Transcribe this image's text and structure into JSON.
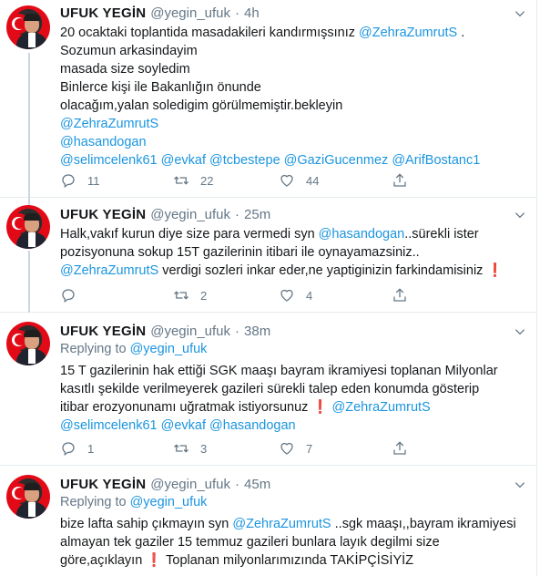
{
  "colors": {
    "link": "#1b95e0",
    "muted": "#657786",
    "text": "#14171a",
    "alarm": "#e0245e"
  },
  "icons": {
    "reply": "reply-icon",
    "retweet": "retweet-icon",
    "like": "heart-icon",
    "share": "share-icon",
    "caret": "chevron-down-icon"
  },
  "tweets": [
    {
      "name": "UFUK YEGİN",
      "handle": "@yegin_ufuk",
      "dot": "·",
      "time": "4h",
      "lines": [
        {
          "a": "20 ocaktaki toplantida masadakileri kandırmışsınız ",
          "m": "@ZehraZumrutS",
          "b": " ."
        },
        {
          "a": "Sozumun arkasindayim"
        },
        {
          "a": "masada size soyledim"
        },
        {
          "a": "Binlerce kişi ile Bakanlığın önunde"
        },
        {
          "a": "olacağım,yalan soledigim görülmemiştir.bekleyin"
        },
        {
          "m": "@ZehraZumrutS"
        },
        {
          "m": "@hasandogan"
        },
        {
          "m": "@selimcelenk61 @evkaf @tcbestepe @GaziGucenmez @ArifBostanc1"
        }
      ],
      "replies": "11",
      "retweets": "22",
      "likes": "44"
    },
    {
      "name": "UFUK YEGİN",
      "handle": "@yegin_ufuk",
      "dot": "·",
      "time": "25m",
      "lines": [
        {
          "a": "Halk,vakıf kurun diye size para vermedi syn ",
          "m": "@hasandogan",
          "b": "..sürekli ister"
        },
        {
          "a": "pozisyonuna sokup 15T gazilerinin itibari ile oynayamazsiniz.."
        },
        {
          "m": "@ZehraZumrutS",
          "b": " verdigi sozleri inkar eder,ne yaptiginizin farkindamisiniz ",
          "e": "❗"
        }
      ],
      "replies": "",
      "retweets": "2",
      "likes": "4"
    },
    {
      "name": "UFUK YEGİN",
      "handle": "@yegin_ufuk",
      "dot": "·",
      "time": "38m",
      "replying_prefix": "Replying to ",
      "replying_to": "@yegin_ufuk",
      "lines": [
        {
          "a": "15 T gazilerinin hak ettiği SGK maaşı bayram ikramiyesi toplanan Milyonlar"
        },
        {
          "a": "kasıtlı şekilde verilmeyerek gazileri sürekli talep eden konumda gösterip"
        },
        {
          "a": "itibar erozyonunamı uğratmak istiyorsunuz ",
          "e": "❗",
          "b": " ",
          "m": "@ZehraZumrutS"
        },
        {
          "m": "@selimcelenk61 @evkaf @hasandogan"
        }
      ],
      "replies": "1",
      "retweets": "3",
      "likes": "7"
    },
    {
      "name": "UFUK YEGİN",
      "handle": "@yegin_ufuk",
      "dot": "·",
      "time": "45m",
      "replying_prefix": "Replying to ",
      "replying_to": "@yegin_ufuk",
      "lines": [
        {
          "a": "bize lafta sahip çıkmayın syn ",
          "m": "@ZehraZumrutS",
          "b": " ..sgk maaşı,,bayram ikramiyesi"
        },
        {
          "a": "almayan tek gaziler 15 temmuz gazileri bunlara layık degilmi size"
        },
        {
          "a": "göre,açıklayın ",
          "e": "❗",
          "b": " Toplanan milyonlarımızında TAKİPÇİSİYİZ"
        }
      ]
    }
  ]
}
